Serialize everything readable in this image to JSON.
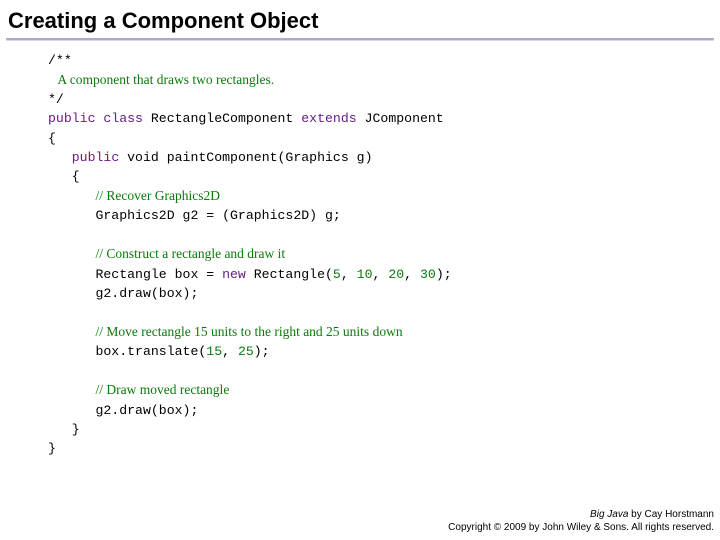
{
  "title": "Creating a Component Object",
  "code": {
    "c1": "/**",
    "c2": "   A component that draws two rectangles.",
    "c3": "*/",
    "k_public": "public",
    "k_class": "class",
    "t_classname": " RectangleComponent ",
    "k_extends": "extends",
    "t_super": " JComponent",
    "brace_o": "{",
    "t_void": " void",
    "t_method": " paintComponent(Graphics g)",
    "c4": "// Recover Graphics2D",
    "l_g2": "      Graphics2D g2 = (Graphics2D) g;",
    "c5": "// Construct a rectangle and draw it",
    "l_box1a": "      Rectangle box = ",
    "k_new": "new",
    "l_box1b": " Rectangle(",
    "n5": "5",
    "n10": "10",
    "n20": "20",
    "n30": "30",
    "l_box1c": ");",
    "l_draw1": "      g2.draw(box);",
    "c6": "// Move rectangle 15 units to the right and 25 units down",
    "l_trans_a": "      box.translate(",
    "n15": "15",
    "n25": "25",
    "l_trans_b": ");",
    "c7": "// Draw moved rectangle",
    "l_draw2": "      g2.draw(box);",
    "brace_c1": "   }",
    "brace_c2": "}",
    "sep": ", "
  },
  "footer": {
    "book": "Big Java",
    "byline": " by Cay Horstmann",
    "copyright": "Copyright © 2009 by John Wiley & Sons. All rights reserved."
  }
}
